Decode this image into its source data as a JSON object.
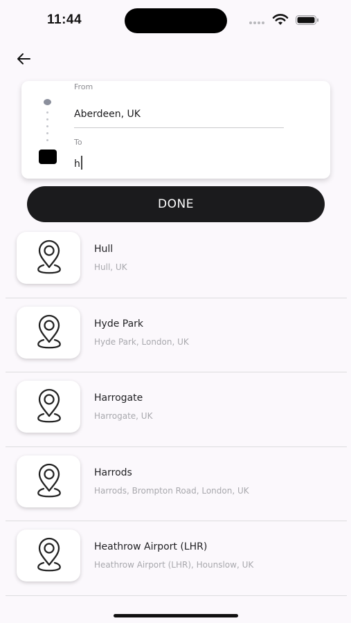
{
  "status": {
    "time": "11:44"
  },
  "route": {
    "from_label": "From",
    "from_value": "Aberdeen, UK",
    "to_label": "To",
    "to_value": "h"
  },
  "done_label": "DONE",
  "results": [
    {
      "title": "Hull",
      "subtitle": "Hull, UK"
    },
    {
      "title": "Hyde Park",
      "subtitle": "Hyde Park, London, UK"
    },
    {
      "title": "Harrogate",
      "subtitle": "Harrogate, UK"
    },
    {
      "title": "Harrods",
      "subtitle": "Harrods, Brompton Road, London, UK"
    },
    {
      "title": "Heathrow Airport (LHR)",
      "subtitle": "Heathrow Airport (LHR), Hounslow, UK"
    }
  ],
  "icons": {
    "back": "arrow-left-icon",
    "result": "map-pin-icon",
    "wifi": "wifi-icon",
    "battery": "battery-icon"
  },
  "colors": {
    "background": "#fbf8fc",
    "primary": "#1b1b1d",
    "muted_text": "#a8a8ad"
  }
}
